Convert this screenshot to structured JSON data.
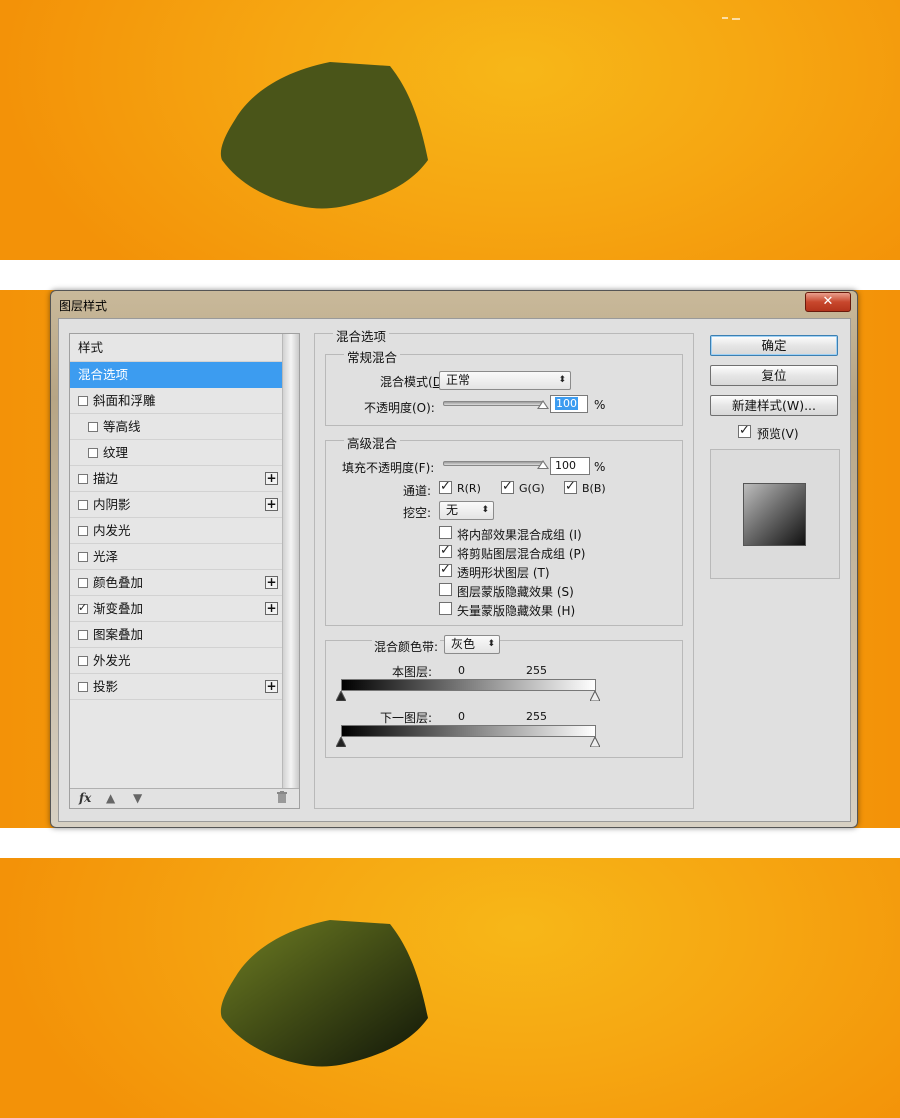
{
  "dialog": {
    "title": "图层样式",
    "close_glyph": "✕"
  },
  "styles_list": {
    "header": "样式",
    "items": [
      {
        "label": "混合选项",
        "selected": true,
        "checkbox": false,
        "checked": false,
        "plus": false,
        "indent": false
      },
      {
        "label": "斜面和浮雕",
        "selected": false,
        "checkbox": true,
        "checked": false,
        "plus": false,
        "indent": false
      },
      {
        "label": "等高线",
        "selected": false,
        "checkbox": true,
        "checked": false,
        "plus": false,
        "indent": true
      },
      {
        "label": "纹理",
        "selected": false,
        "checkbox": true,
        "checked": false,
        "plus": false,
        "indent": true
      },
      {
        "label": "描边",
        "selected": false,
        "checkbox": true,
        "checked": false,
        "plus": true,
        "indent": false
      },
      {
        "label": "内阴影",
        "selected": false,
        "checkbox": true,
        "checked": false,
        "plus": true,
        "indent": false
      },
      {
        "label": "内发光",
        "selected": false,
        "checkbox": true,
        "checked": false,
        "plus": false,
        "indent": false
      },
      {
        "label": "光泽",
        "selected": false,
        "checkbox": true,
        "checked": false,
        "plus": false,
        "indent": false
      },
      {
        "label": "颜色叠加",
        "selected": false,
        "checkbox": true,
        "checked": false,
        "plus": true,
        "indent": false
      },
      {
        "label": "渐变叠加",
        "selected": false,
        "checkbox": true,
        "checked": true,
        "plus": true,
        "indent": false
      },
      {
        "label": "图案叠加",
        "selected": false,
        "checkbox": true,
        "checked": false,
        "plus": false,
        "indent": false
      },
      {
        "label": "外发光",
        "selected": false,
        "checkbox": true,
        "checked": false,
        "plus": false,
        "indent": false
      },
      {
        "label": "投影",
        "selected": false,
        "checkbox": true,
        "checked": false,
        "plus": true,
        "indent": false
      }
    ],
    "footer": {
      "fx": "fx",
      "up_icon": "arrow-up-icon",
      "down_icon": "arrow-down-icon",
      "trash_icon": "trash-icon"
    }
  },
  "blending": {
    "section_title": "混合选项",
    "general": {
      "title": "常规混合",
      "mode_label": "混合模式(",
      "mode_label_rest": "):",
      "mode_value": "正常",
      "opacity_label": "不透明度(O):",
      "opacity_value": "100",
      "opacity_unit": "%"
    },
    "advanced": {
      "title": "高级混合",
      "fill_label": "填充不透明度(F):",
      "fill_value": "100",
      "fill_unit": "%",
      "channels_label": "通道:",
      "channels": [
        {
          "label": "R(R)",
          "checked": true
        },
        {
          "label": "G(G)",
          "checked": true
        },
        {
          "label": "B(B)",
          "checked": true
        }
      ],
      "knockout_label": "挖空:",
      "knockout_value": "无",
      "options": [
        {
          "label": "将内部效果混合成组 (I)",
          "checked": false
        },
        {
          "label": "将剪贴图层混合成组 (P)",
          "checked": true
        },
        {
          "label": "透明形状图层 (T)",
          "checked": true
        },
        {
          "label": "图层蒙版隐藏效果 (S)",
          "checked": false
        },
        {
          "label": "矢量蒙版隐藏效果 (H)",
          "checked": false
        }
      ]
    },
    "blend_if": {
      "label": "混合颜色带:",
      "value": "灰色",
      "this_layer_label": "本图层:",
      "this_layer_low": "0",
      "this_layer_high": "255",
      "underlying_label": "下一图层:",
      "underlying_low": "0",
      "underlying_high": "255"
    }
  },
  "buttons": {
    "ok": "确定",
    "reset": "复位",
    "new_style": "新建样式(W)...",
    "preview_label": "预览(V)",
    "preview_checked": true
  },
  "colors": {
    "canvas_orange": "#f6a712",
    "shape_before": "#4a5519",
    "shape_after_light": "#6f7e23",
    "shape_after_dark": "#101508",
    "selection_blue": "#3c9cf0"
  }
}
